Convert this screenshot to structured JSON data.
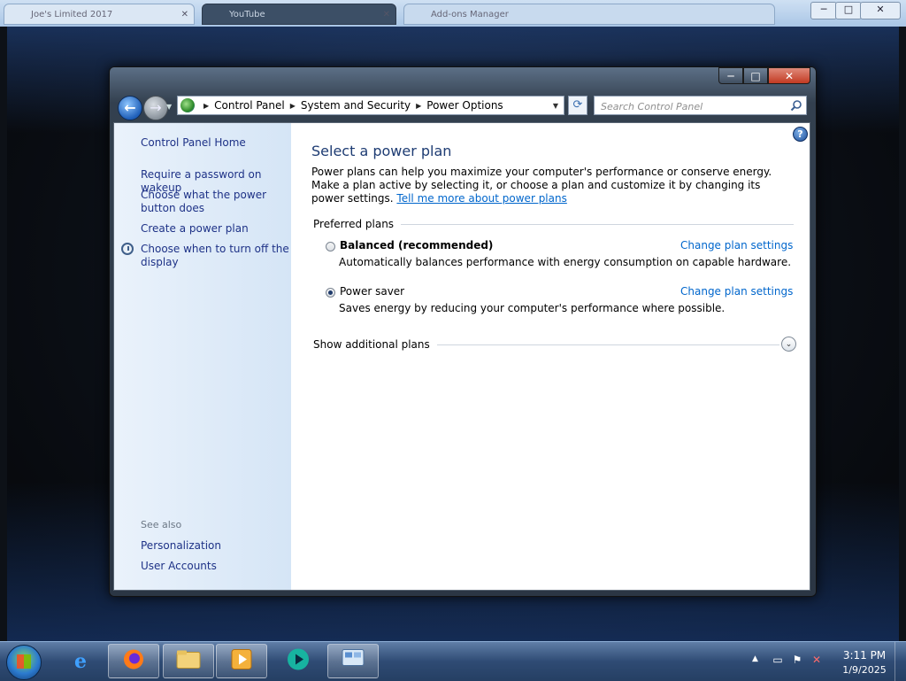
{
  "outer_window": {
    "tabs": [
      {
        "label": "Joe's Limited 2017"
      },
      {
        "label": "YouTube"
      },
      {
        "label": "Add-ons Manager"
      }
    ],
    "minimize": "─",
    "maximize": "□",
    "close": "✕"
  },
  "window": {
    "minimize": "─",
    "maximize": "□",
    "close": "✕"
  },
  "nav": {
    "back_glyph": "←",
    "forward_glyph": "→",
    "history_glyph": "▼",
    "crumb_separator": "▶",
    "breadcrumbs": [
      "Control Panel",
      "System and Security",
      "Power Options"
    ],
    "dropdown_glyph": "▼",
    "refresh_glyph": "⟳",
    "search_placeholder": "Search Control Panel"
  },
  "sidebar": {
    "home": "Control Panel Home",
    "items": [
      "Require a password on wakeup",
      "Choose what the power button does",
      "Create a power plan",
      "Choose when to turn off the display"
    ],
    "see_also_label": "See also",
    "see_also": [
      "Personalization",
      "User Accounts"
    ]
  },
  "main": {
    "help_glyph": "?",
    "title": "Select a power plan",
    "description": "Power plans can help you maximize your computer's performance or conserve energy. Make a plan active by selecting it, or choose a plan and customize it by changing its power settings.",
    "tell_me_more_link": "Tell me more about power plans",
    "preferred_header": "Preferred plans",
    "plans": [
      {
        "name": "Balanced (recommended)",
        "description": "Automatically balances performance with energy consumption on capable hardware.",
        "link": "Change plan settings",
        "selected": false
      },
      {
        "name": "Power saver",
        "description": "Saves energy by reducing your computer's performance where possible.",
        "link": "Change plan settings",
        "selected": true
      }
    ],
    "additional_header": "Show additional plans",
    "expand_glyph": "⌄"
  },
  "taskbar": {
    "tray_arrow": "▲",
    "time": "3:11 PM",
    "date": "1/9/2025"
  },
  "colors": {
    "link": "#0066cc",
    "task_link": "#1e3287",
    "title": "#1e3c73"
  }
}
